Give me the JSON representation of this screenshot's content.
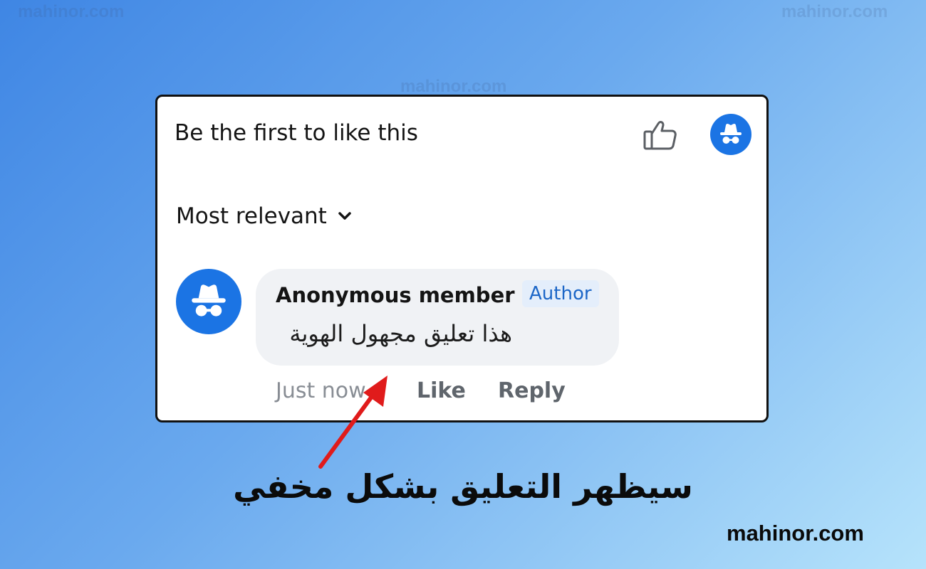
{
  "watermarks": {
    "top_left": "mahinor.com",
    "top_right": "mahinor.com",
    "center": "mahinor.com",
    "bottom_right": "mahinor.com"
  },
  "header": {
    "reaction_text": "Be the first to like this",
    "like_icon": "thumbs-up-icon",
    "avatar_icon": "incognito-icon"
  },
  "sort": {
    "label": "Most relevant",
    "icon": "chevron-down-icon"
  },
  "comment": {
    "avatar_icon": "incognito-icon",
    "author_name": "Anonymous member",
    "badge": "Author",
    "text": "هذا تعليق مجهول الهوية",
    "time": "Just now",
    "like_label": "Like",
    "reply_label": "Reply"
  },
  "caption": "سيظهر التعليق بشكل مخفي",
  "colors": {
    "accent": "#1b74e4",
    "badge_bg": "#e4eefb",
    "badge_text": "#1c66c7",
    "bubble_bg": "#f0f2f5",
    "arrow": "#e01b1b"
  }
}
